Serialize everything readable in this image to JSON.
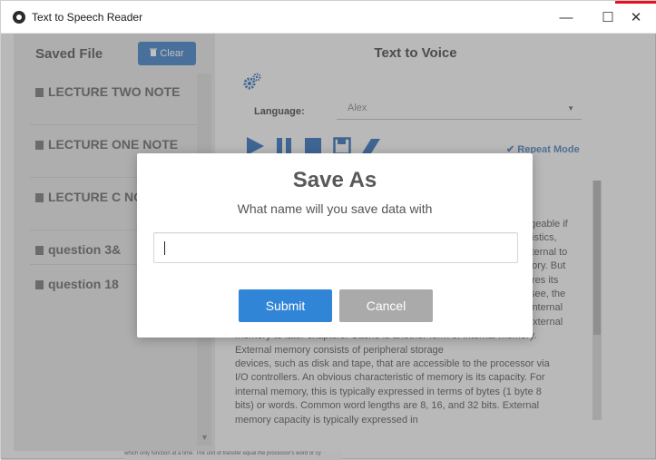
{
  "window": {
    "title": "Text to Speech Reader",
    "controls": {
      "minimize": "—",
      "maximize": "☐",
      "close": "✕"
    }
  },
  "sidebar": {
    "title": "Saved File",
    "clear_label": "Clear",
    "items": [
      {
        "label": "LECTURE TWO NOTE"
      },
      {
        "label": "LECTURE ONE NOTE"
      },
      {
        "label": "LECTURE C NOTE"
      },
      {
        "label": "question 3&"
      },
      {
        "label": "question 18"
      }
    ]
  },
  "main": {
    "title": "Text to Voice",
    "language_label": "Language:",
    "language_value": "Alex",
    "repeat_mode": "Repeat Mode",
    "text_lines": [
      "ageable if",
      "istics,",
      "xternal to",
      "mory. But",
      "res its",
      "see, the",
      "internal",
      "external",
      "memory to later chapters. Cache is another form of internal memory.",
      "External memory consists of peripheral storage",
      "devices, such as disk and tape, that are accessible to the processor via",
      "I/O controllers. An obvious characteristic of memory is its capacity. For",
      "internal memory, this is typically expressed in terms of bytes (1 byte 8",
      "bits) or words. Common word lengths are 8, 16, and 32 bits. External",
      "memory capacity is typically expressed in"
    ],
    "footer_text": "which only function at a time. The unit of transfer equal the processor's word or cy"
  },
  "dialog": {
    "title": "Save As",
    "subtitle": "What name will you save data with",
    "input_value": "",
    "submit_label": "Submit",
    "cancel_label": "Cancel"
  },
  "colors": {
    "submit": "#3085d6",
    "cancel": "#aaaaaa",
    "clear_button": "#3f7fc2",
    "toolbar_icons": "#2f6db5"
  },
  "icons": {
    "app": "app-logo-icon",
    "clear": "trash-icon",
    "file": "book-icon",
    "settings": "gears-icon",
    "play": "play-icon",
    "pause": "pause-icon",
    "stop": "stop-icon",
    "save": "floppy-disk-icon",
    "eraser": "eraser-icon"
  }
}
